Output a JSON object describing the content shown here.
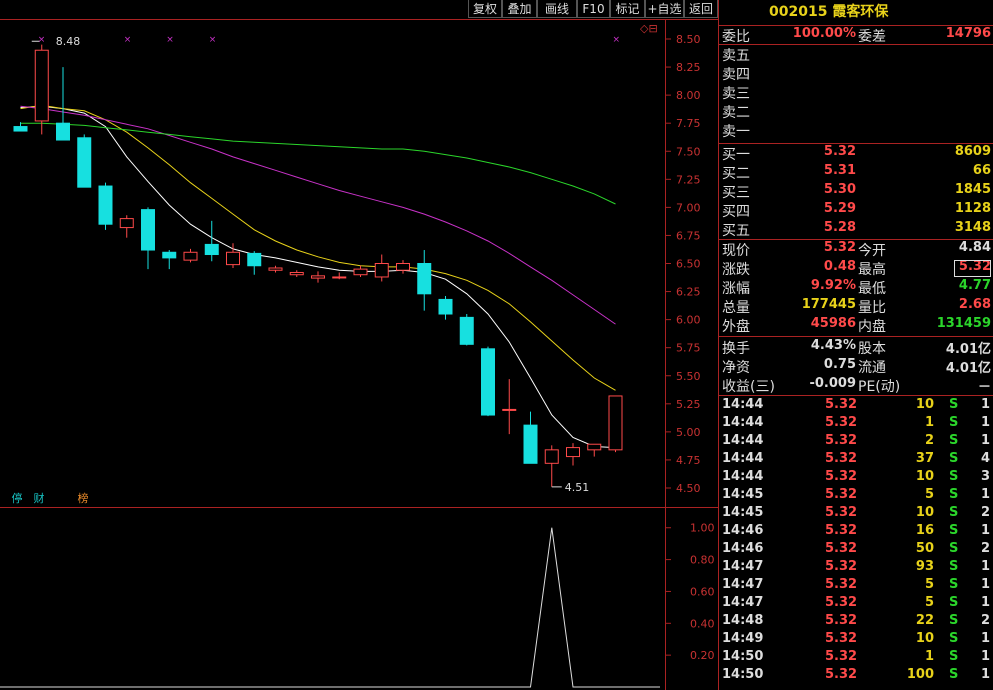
{
  "toolbar": {
    "buttons": [
      "复权",
      "叠加",
      "画线",
      "F10",
      "标记",
      "+自选",
      "返回"
    ]
  },
  "chart": {
    "high_label": "8.48",
    "low_label": "4.51",
    "price_axis": [
      "8.50",
      "8.25",
      "8.00",
      "7.75",
      "7.50",
      "7.25",
      "7.00",
      "6.75",
      "6.50",
      "6.25",
      "6.00",
      "5.75",
      "5.50",
      "5.25",
      "5.00",
      "4.75",
      "4.50"
    ],
    "indicator_axis": [
      "1.00",
      "0.80",
      "0.60",
      "0.40",
      "0.20"
    ],
    "badges": [
      {
        "text": "停",
        "color": "#17c2c2"
      },
      {
        "text": "财",
        "color": "#17c2c2"
      },
      {
        "text": "榜",
        "color": "#e88a2a"
      }
    ],
    "corner_icons": "◇⊟"
  },
  "chart_data": {
    "type": "candlestick",
    "ylim": [
      4.5,
      8.5
    ],
    "candles": [
      {
        "o": 7.72,
        "h": 7.76,
        "l": 7.68,
        "c": 7.68
      },
      {
        "o": 7.77,
        "h": 8.45,
        "l": 7.65,
        "c": 8.4
      },
      {
        "o": 7.75,
        "h": 8.25,
        "l": 7.6,
        "c": 7.6
      },
      {
        "o": 7.62,
        "h": 7.65,
        "l": 7.18,
        "c": 7.18
      },
      {
        "o": 7.19,
        "h": 7.22,
        "l": 6.8,
        "c": 6.85
      },
      {
        "o": 6.82,
        "h": 6.93,
        "l": 6.73,
        "c": 6.9
      },
      {
        "o": 6.98,
        "h": 7.0,
        "l": 6.45,
        "c": 6.62
      },
      {
        "o": 6.6,
        "h": 6.62,
        "l": 6.45,
        "c": 6.55
      },
      {
        "o": 6.53,
        "h": 6.63,
        "l": 6.51,
        "c": 6.6
      },
      {
        "o": 6.67,
        "h": 6.88,
        "l": 6.52,
        "c": 6.58
      },
      {
        "o": 6.49,
        "h": 6.68,
        "l": 6.46,
        "c": 6.6
      },
      {
        "o": 6.59,
        "h": 6.61,
        "l": 6.4,
        "c": 6.48
      },
      {
        "o": 6.44,
        "h": 6.48,
        "l": 6.42,
        "c": 6.46
      },
      {
        "o": 6.4,
        "h": 6.44,
        "l": 6.38,
        "c": 6.42
      },
      {
        "o": 6.37,
        "h": 6.43,
        "l": 6.33,
        "c": 6.39
      },
      {
        "o": 6.38,
        "h": 6.42,
        "l": 6.36,
        "c": 6.38
      },
      {
        "o": 6.4,
        "h": 6.48,
        "l": 6.38,
        "c": 6.45
      },
      {
        "o": 6.38,
        "h": 6.58,
        "l": 6.34,
        "c": 6.5
      },
      {
        "o": 6.44,
        "h": 6.53,
        "l": 6.41,
        "c": 6.5
      },
      {
        "o": 6.5,
        "h": 6.62,
        "l": 6.08,
        "c": 6.23
      },
      {
        "o": 6.18,
        "h": 6.21,
        "l": 6.0,
        "c": 6.05
      },
      {
        "o": 6.02,
        "h": 6.05,
        "l": 5.77,
        "c": 5.78
      },
      {
        "o": 5.74,
        "h": 5.76,
        "l": 5.14,
        "c": 5.15
      },
      {
        "o": 5.2,
        "h": 5.47,
        "l": 4.98,
        "c": 5.2
      },
      {
        "o": 5.06,
        "h": 5.18,
        "l": 4.72,
        "c": 4.72
      },
      {
        "o": 4.72,
        "h": 4.88,
        "l": 4.51,
        "c": 4.84
      },
      {
        "o": 4.78,
        "h": 4.9,
        "l": 4.7,
        "c": 4.86
      },
      {
        "o": 4.84,
        "h": 4.88,
        "l": 4.78,
        "c": 4.89
      },
      {
        "o": 4.84,
        "h": 5.32,
        "l": 4.82,
        "c": 5.32
      }
    ],
    "ma": [
      {
        "color": "#ffffff",
        "values": [
          7.89,
          7.9,
          7.88,
          7.84,
          7.72,
          7.45,
          7.23,
          7.02,
          6.85,
          6.73,
          6.63,
          6.58,
          6.55,
          6.51,
          6.47,
          6.44,
          6.43,
          6.43,
          6.44,
          6.42,
          6.36,
          6.23,
          6.05,
          5.8,
          5.48,
          5.15,
          4.95,
          4.87,
          4.86
        ]
      },
      {
        "color": "#e8d21a",
        "values": [
          7.88,
          7.91,
          7.88,
          7.86,
          7.78,
          7.67,
          7.53,
          7.38,
          7.22,
          7.08,
          6.94,
          6.8,
          6.7,
          6.62,
          6.56,
          6.51,
          6.48,
          6.47,
          6.47,
          6.45,
          6.41,
          6.35,
          6.26,
          6.14,
          5.98,
          5.81,
          5.64,
          5.48,
          5.37
        ]
      },
      {
        "color": "#c832c8",
        "values": [
          7.9,
          7.88,
          7.85,
          7.82,
          7.78,
          7.74,
          7.7,
          7.64,
          7.58,
          7.52,
          7.45,
          7.39,
          7.33,
          7.27,
          7.21,
          7.15,
          7.1,
          7.05,
          7.0,
          6.94,
          6.87,
          6.79,
          6.7,
          6.59,
          6.47,
          6.35,
          6.22,
          6.09,
          5.96
        ]
      },
      {
        "color": "#2bd52b",
        "values": [
          7.75,
          7.75,
          7.74,
          7.73,
          7.71,
          7.69,
          7.67,
          7.65,
          7.63,
          7.61,
          7.59,
          7.58,
          7.57,
          7.56,
          7.55,
          7.54,
          7.53,
          7.52,
          7.52,
          7.5,
          7.47,
          7.44,
          7.4,
          7.36,
          7.31,
          7.25,
          7.19,
          7.12,
          7.03
        ]
      }
    ],
    "indicator": {
      "ylim": [
        0,
        1.08
      ],
      "values": [
        0,
        0,
        0,
        0,
        0,
        0,
        0,
        0,
        0,
        0,
        0,
        0,
        0,
        0,
        0,
        0,
        0,
        0,
        0,
        0,
        0,
        0,
        0,
        0,
        0,
        1,
        0,
        0,
        0
      ]
    }
  },
  "quote": {
    "code": "002015",
    "name": "霞客环保",
    "weibi_label": "委比",
    "weibi": "100.00%",
    "weicha_label": "委差",
    "weicha": "14796",
    "sell": [
      {
        "label": "卖五",
        "price": "",
        "vol": ""
      },
      {
        "label": "卖四",
        "price": "",
        "vol": ""
      },
      {
        "label": "卖三",
        "price": "",
        "vol": ""
      },
      {
        "label": "卖二",
        "price": "",
        "vol": ""
      },
      {
        "label": "卖一",
        "price": "",
        "vol": ""
      }
    ],
    "buy": [
      {
        "label": "买一",
        "price": "5.32",
        "vol": "8609"
      },
      {
        "label": "买二",
        "price": "5.31",
        "vol": "66"
      },
      {
        "label": "买三",
        "price": "5.30",
        "vol": "1845"
      },
      {
        "label": "买四",
        "price": "5.29",
        "vol": "1128"
      },
      {
        "label": "买五",
        "price": "5.28",
        "vol": "3148"
      }
    ],
    "stats1": [
      {
        "l1": "现价",
        "v1": "5.32",
        "c1": "red",
        "l2": "今开",
        "v2": "4.84",
        "c2": "white"
      },
      {
        "l1": "涨跌",
        "v1": "0.48",
        "c1": "red",
        "l2": "最高",
        "v2": "5.32",
        "c2": "red"
      },
      {
        "l1": "涨幅",
        "v1": "9.92%",
        "c1": "red",
        "l2": "最低",
        "v2": "4.77",
        "c2": "green"
      },
      {
        "l1": "总量",
        "v1": "177445",
        "c1": "yellow",
        "l2": "量比",
        "v2": "2.68",
        "c2": "red"
      },
      {
        "l1": "外盘",
        "v1": "45986",
        "c1": "red",
        "l2": "内盘",
        "v2": "131459",
        "c2": "green"
      }
    ],
    "stats2": [
      {
        "l1": "换手",
        "v1": "4.43%",
        "c1": "white",
        "l2": "股本",
        "v2": "4.01亿",
        "c2": "white"
      },
      {
        "l1": "净资",
        "v1": "0.75",
        "c1": "white",
        "l2": "流通",
        "v2": "4.01亿",
        "c2": "white"
      },
      {
        "l1": "收益(三)",
        "v1": "-0.009",
        "c1": "white",
        "l2": "PE(动)",
        "v2": "－",
        "c2": "white"
      }
    ],
    "ticks": [
      {
        "t": "14:44",
        "p": "5.32",
        "v": "10",
        "s": "S",
        "n": "1"
      },
      {
        "t": "14:44",
        "p": "5.32",
        "v": "1",
        "s": "S",
        "n": "1"
      },
      {
        "t": "14:44",
        "p": "5.32",
        "v": "2",
        "s": "S",
        "n": "1"
      },
      {
        "t": "14:44",
        "p": "5.32",
        "v": "37",
        "s": "S",
        "n": "4"
      },
      {
        "t": "14:44",
        "p": "5.32",
        "v": "10",
        "s": "S",
        "n": "3"
      },
      {
        "t": "14:45",
        "p": "5.32",
        "v": "5",
        "s": "S",
        "n": "1"
      },
      {
        "t": "14:45",
        "p": "5.32",
        "v": "10",
        "s": "S",
        "n": "2"
      },
      {
        "t": "14:46",
        "p": "5.32",
        "v": "16",
        "s": "S",
        "n": "1"
      },
      {
        "t": "14:46",
        "p": "5.32",
        "v": "50",
        "s": "S",
        "n": "2"
      },
      {
        "t": "14:47",
        "p": "5.32",
        "v": "93",
        "s": "S",
        "n": "1"
      },
      {
        "t": "14:47",
        "p": "5.32",
        "v": "5",
        "s": "S",
        "n": "1"
      },
      {
        "t": "14:47",
        "p": "5.32",
        "v": "5",
        "s": "S",
        "n": "1"
      },
      {
        "t": "14:48",
        "p": "5.32",
        "v": "22",
        "s": "S",
        "n": "2"
      },
      {
        "t": "14:49",
        "p": "5.32",
        "v": "10",
        "s": "S",
        "n": "1"
      },
      {
        "t": "14:50",
        "p": "5.32",
        "v": "1",
        "s": "S",
        "n": "1"
      },
      {
        "t": "14:50",
        "p": "5.32",
        "v": "100",
        "s": "S",
        "n": "1"
      }
    ]
  }
}
